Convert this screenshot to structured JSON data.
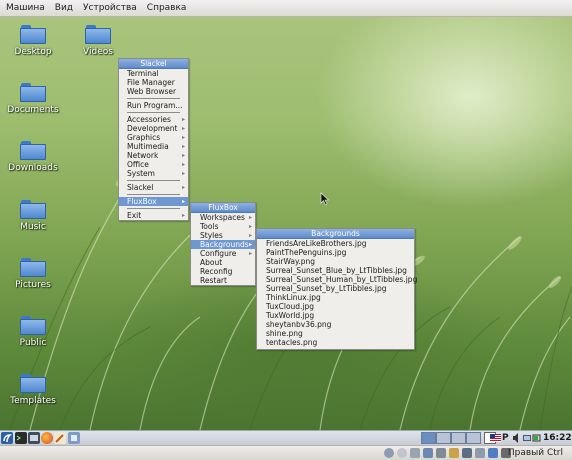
{
  "vbox": {
    "menubar": [
      "Машина",
      "Вид",
      "Устройства",
      "Справка"
    ],
    "status_host_key": "Правый Ctrl"
  },
  "desktop": {
    "icons": [
      "Desktop",
      "Videos",
      "Documents",
      "Downloads",
      "Music",
      "Pictures",
      "Public",
      "Templates"
    ]
  },
  "menu_root": {
    "title": "Slackel",
    "items": [
      "Terminal",
      "File Manager",
      "Web Browser",
      "Run Program...",
      "Accessories",
      "Development",
      "Graphics",
      "Multimedia",
      "Network",
      "Office",
      "System",
      "Slackel",
      "FluxBox",
      "Exit"
    ]
  },
  "menu_fluxbox": {
    "title": "FluxBox",
    "items": [
      "Workspaces",
      "Tools",
      "Styles",
      "Backgrounds",
      "Configure",
      "About",
      "Reconfig",
      "Restart"
    ]
  },
  "menu_backgrounds": {
    "title": "Backgrounds",
    "items": [
      "FriendsAreLikeBrothers.jpg",
      "PaintThePenguins.jpg",
      "StairWay.png",
      "Surreal_Sunset_Blue_by_LtTibbles.jpg",
      "Surreal_Sunset_Human_by_LtTibbles.jpg",
      "Surreal_Sunset_by_LtTibbles.jpg",
      "ThinkLinux.jpg",
      "TuxCloud.jpg",
      "TuxWorld.jpg",
      "sheytanbv36.png",
      "shine.png",
      "tentacles.png"
    ]
  },
  "toolbar": {
    "keyboard_layout": "P",
    "clock": "16:22",
    "icons": [
      "slackel-menu-icon",
      "terminal-icon",
      "firefox-icon",
      "text-editor-icon",
      "file-manager-icon",
      "workspace-pager",
      "us-flag-icon",
      "volume-icon",
      "network-icon",
      "battery-icon"
    ],
    "colors": {
      "highlight": "#6f97d1",
      "title": "#5e8bcb",
      "workspace_active": "#6a8dc4"
    }
  }
}
